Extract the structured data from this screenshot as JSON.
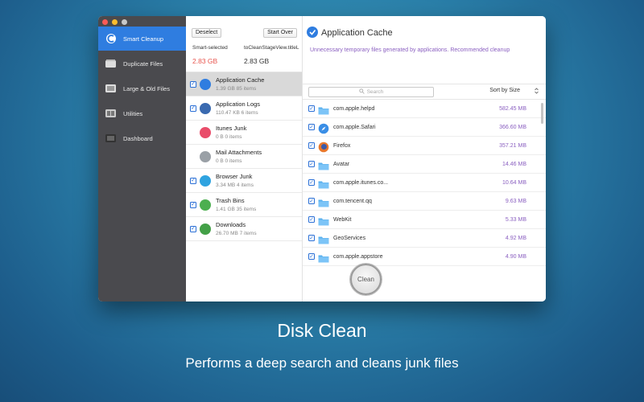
{
  "sidebar": {
    "items": [
      {
        "label": "Smart Cleanup",
        "icon": "smart-cleanup-icon",
        "active": true
      },
      {
        "label": "Duplicate Files",
        "icon": "duplicate-files-icon",
        "active": false
      },
      {
        "label": "Large & Old Files",
        "icon": "large-old-files-icon",
        "active": false
      },
      {
        "label": "Utilities",
        "icon": "utilities-icon",
        "active": false
      },
      {
        "label": "Dashboard",
        "icon": "dashboard-icon",
        "active": false
      }
    ]
  },
  "summary": {
    "deselect_label": "Deselect",
    "start_over_label": "Start Over",
    "smart_selected_label": "Smart-selected",
    "smart_selected_value": "2.83 GB",
    "to_clean_label": "toCleanStageView.titleL",
    "to_clean_value": "2.83 GB",
    "smart_selected_color": "#e8554e"
  },
  "categories": [
    {
      "name": "Application Cache",
      "sub": "1.39 GB   85 items",
      "checked": true,
      "active": true,
      "icon": "application-cache-icon",
      "color": "#2f7de0"
    },
    {
      "name": "Application Logs",
      "sub": "110.47 KB   6 items",
      "checked": true,
      "active": false,
      "icon": "application-logs-icon",
      "color": "#3a6ab0"
    },
    {
      "name": "Itunes Junk",
      "sub": "0 B   0 items",
      "checked": false,
      "active": false,
      "icon": "itunes-icon",
      "color": "#e94d6a"
    },
    {
      "name": "Mail Attachments",
      "sub": "0 B   0 items",
      "checked": false,
      "active": false,
      "icon": "mail-icon",
      "color": "#9aa0a6"
    },
    {
      "name": "Browser Junk",
      "sub": "3.34 MB   4 items",
      "checked": true,
      "active": false,
      "icon": "browser-icon",
      "color": "#2fa3e0"
    },
    {
      "name": "Trash Bins",
      "sub": "1.41 GB   35 items",
      "checked": true,
      "active": false,
      "icon": "trash-icon",
      "color": "#4caf50"
    },
    {
      "name": "Downloads",
      "sub": "26.70 MB   7 items",
      "checked": true,
      "active": false,
      "icon": "downloads-icon",
      "color": "#43a047"
    }
  ],
  "detail": {
    "title": "Application Cache",
    "description": "Unnecessary temporary files generated by applications. Recommended cleanup",
    "search_placeholder": "Search",
    "sort_label": "Sort by Size"
  },
  "files": [
    {
      "name": "com.apple.helpd",
      "size": "582.45 MB",
      "icon": "folder-icon"
    },
    {
      "name": "com.apple.Safari",
      "size": "366.60 MB",
      "icon": "safari-icon"
    },
    {
      "name": "Firefox",
      "size": "357.21 MB",
      "icon": "firefox-icon"
    },
    {
      "name": "Avatar",
      "size": "14.46 MB",
      "icon": "folder-icon"
    },
    {
      "name": "com.apple.itunes.co...",
      "size": "10.64 MB",
      "icon": "folder-icon"
    },
    {
      "name": "com.tencent.qq",
      "size": "9.63 MB",
      "icon": "folder-icon"
    },
    {
      "name": "WebKit",
      "size": "5.33 MB",
      "icon": "folder-icon"
    },
    {
      "name": "GeoServices",
      "size": "4.92 MB",
      "icon": "folder-icon"
    },
    {
      "name": "com.apple.appstore",
      "size": "4.90 MB",
      "icon": "folder-icon"
    }
  ],
  "clean_label": "Clean",
  "caption": {
    "title": "Disk Clean",
    "subtitle": "Performs a deep search and cleans junk files"
  }
}
